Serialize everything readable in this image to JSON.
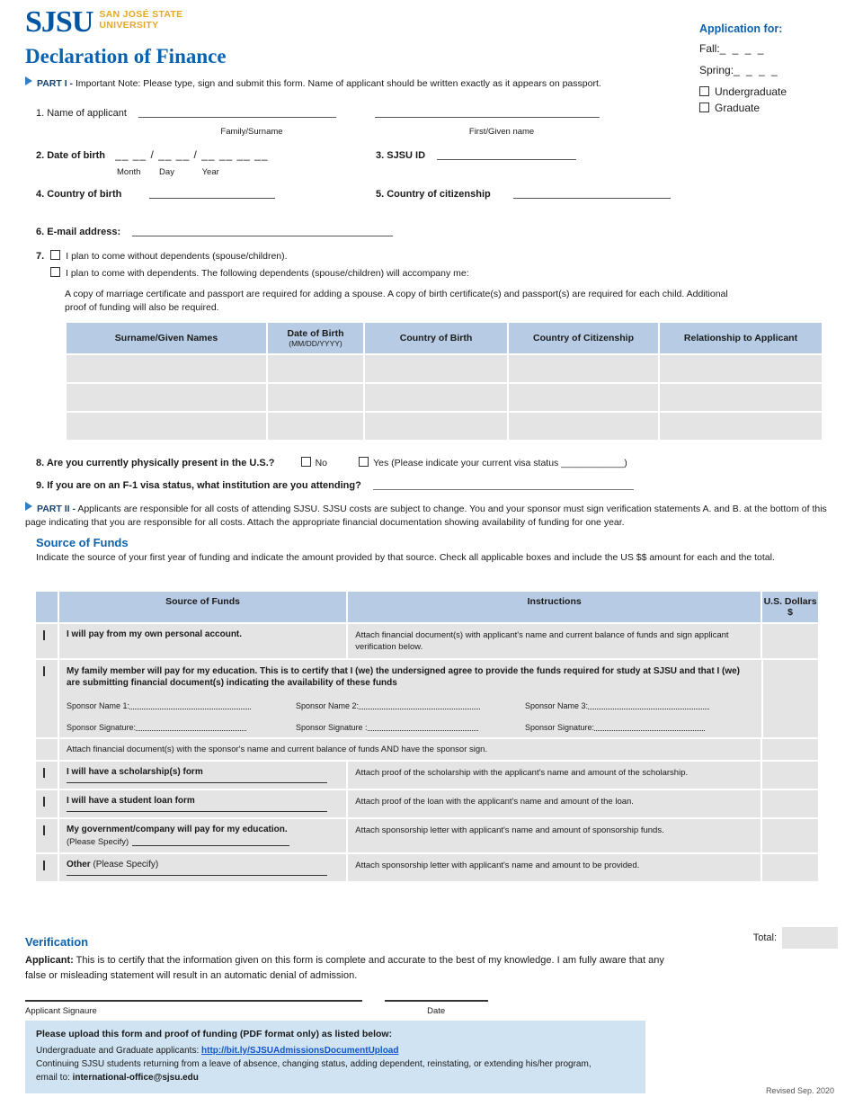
{
  "logo": {
    "main": "SJSU",
    "line1": "SAN JOSÉ STATE",
    "line2": "UNIVERSITY"
  },
  "doc_title": "Declaration of Finance",
  "part1": {
    "label": "PART I -",
    "note": "Important Note: Please type, sign and submit this form. Name of applicant should be written exactly as it appears on passport.",
    "q1": "1. Name of applicant",
    "q1_cap_a": "Family/Surname",
    "q1_cap_b": "First/Given name",
    "q2": "2. Date of birth",
    "q2_dashes": "__ __ / __ __ / __ __ __ __",
    "q2_month": "Month",
    "q2_day": "Day",
    "q2_year": "Year",
    "q3": "3. SJSU ID",
    "q4": "4. Country of birth",
    "q5": "5. Country of citizenship",
    "q6": "6. E-mail address:",
    "q7_num": "7.",
    "q7_opt1": "I plan to come without dependents (spouse/children).",
    "q7_opt2": "I plan to come with dependents. The following dependents (spouse/children) will accompany me:",
    "q7_note": "A copy of marriage certificate and passport are required for adding a spouse. A copy of birth certificate(s) and passport(s) are required for each child. Additional proof of funding will also be required.",
    "q8": "8. Are you currently physically present in the U.S.?",
    "q8_no": "No",
    "q8_yes": "Yes (Please indicate your current visa status ____________)",
    "q9": "9. If you are on an F-1 visa status, what institution are you attending?"
  },
  "application_for": {
    "title": "Application for:",
    "fall_label": "Fall:",
    "fall_value": "_ _ _ _",
    "spring_label": "Spring:",
    "spring_value": "_ _ _ _",
    "undergraduate": "Undergraduate",
    "graduate": "Graduate"
  },
  "dependents_table": {
    "headers": [
      {
        "main": "Surname/Given Names",
        "sub": ""
      },
      {
        "main": "Date of Birth",
        "sub": "(MM/DD/YYYY)"
      },
      {
        "main": "Country of Birth",
        "sub": ""
      },
      {
        "main": "Country of Citizenship",
        "sub": ""
      },
      {
        "main": "Relationship to Applicant",
        "sub": ""
      }
    ],
    "row_count": 3
  },
  "part2": {
    "label": "PART II -",
    "text": "Applicants are responsible for all costs of attending SJSU. SJSU costs are subject to change. You and your sponsor must sign verification statements A. and B. at the bottom of this page indicating that you are responsible for all costs. Attach the appropriate financial documentation showing availability of funding for one year.",
    "source_title": "Source of Funds",
    "source_desc": "Indicate the source of your first year of funding and indicate the amount provided by that source. Check all applicable boxes and include the US $$ amount for each and the total."
  },
  "funds_table": {
    "headers": [
      "Source of Funds",
      "Instructions",
      "U.S. Dollars $"
    ],
    "rows": [
      {
        "source": "I will pay from my own personal account.",
        "instructions": "Attach financial document(s) with applicant's name and current balance of funds and sign applicant verification below."
      },
      {
        "source": "My family member will pay for my education. This is to certify that I (we) the undersigned agree to provide the funds required for study at SJSU and that I (we) are submitting financial document(s) indicating the availability of these funds",
        "instructions": "",
        "sponsors": [
          {
            "name_label": "Sponsor Name 1:",
            "sig_label": "Sponsor Signature:"
          },
          {
            "name_label": "Sponsor Name 2:",
            "sig_label": "Sponsor Signature :"
          },
          {
            "name_label": "Sponsor Name 3:",
            "sig_label": "Sponsor Signature:"
          }
        ],
        "footer": "Attach financial document(s) with the sponsor's name and current balance of funds AND have the sponsor sign."
      },
      {
        "source": "I will have a scholarship(s) form",
        "instructions": "Attach proof of the scholarship with the applicant's name and amount of the scholarship."
      },
      {
        "source": "I will have a student loan form",
        "instructions": "Attach proof of the loan with the applicant's name and amount of the loan."
      },
      {
        "source": "My government/company will pay for my education.",
        "source_sub": "(Please Specify)",
        "instructions": "Attach sponsorship letter with applicant's name and amount of sponsorship funds."
      },
      {
        "source_bold": "Other",
        "source_rest": "(Please Specify)",
        "instructions": "Attach sponsorship letter with applicant's name and amount to be provided."
      }
    ],
    "total_label": "Total:"
  },
  "verification": {
    "title": "Verification",
    "applicant_label": "Applicant:",
    "text": "This is to certify that the information given on this form is complete and accurate to the best of my knowledge. I am fully aware that any false or misleading statement will result in an automatic denial of admission.",
    "sig_caption": "Applicant Signaure",
    "date_caption": "Date"
  },
  "upload_box": {
    "line1": "Please upload this form and proof of funding (PDF format only) as listed below:",
    "line2_prefix": "Undergraduate and Graduate applicants: ",
    "line2_link": "http://bit.ly/SJSUAdmissionsDocumentUpload",
    "line3": "Continuing SJSU students returning from a leave of absence, changing status, adding dependent, reinstating, or extending his/her program,",
    "line4_prefix": "email to: ",
    "line4_email": "international-office@sjsu.edu"
  },
  "footer": {
    "revised": "Revised Sep. 2020"
  },
  "colors": {
    "brand_blue": "#0055a2",
    "brand_gold": "#e5a823",
    "heading_blue": "#0b62ae",
    "table_header": "#b7cce4",
    "table_cell": "#e4e4e4",
    "upload_bg": "#cfe3f2"
  }
}
